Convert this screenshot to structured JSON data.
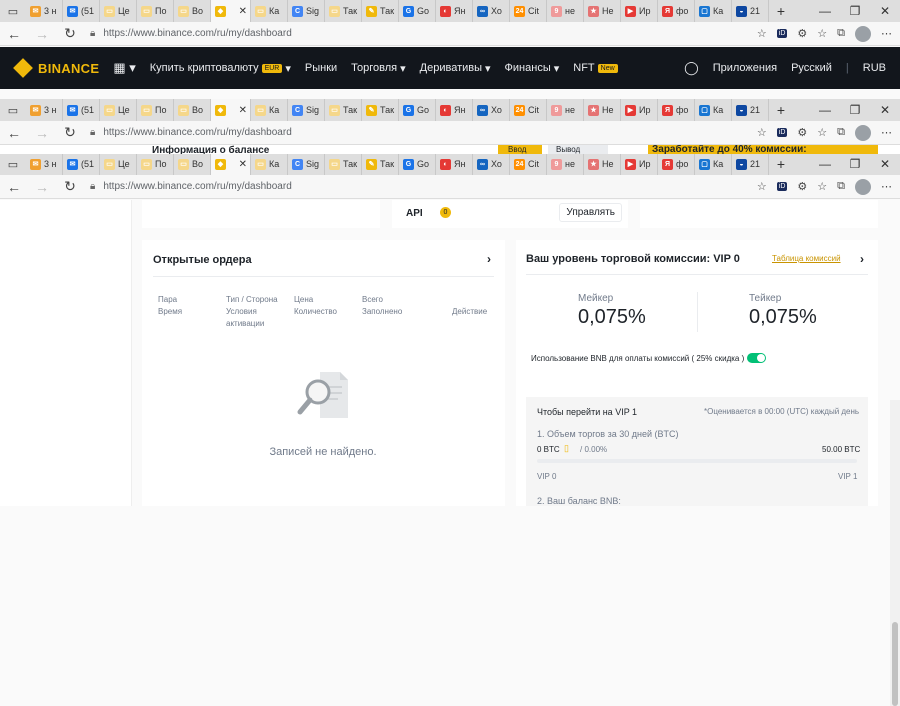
{
  "browser": {
    "tabs": [
      {
        "label": "3 н",
        "color": "#f0a030",
        "glyph": "✉"
      },
      {
        "label": "(51",
        "color": "#1a73e8",
        "glyph": "✉"
      },
      {
        "label": "Це",
        "color": "#f5d78a",
        "glyph": "▭"
      },
      {
        "label": "По",
        "color": "#f5d78a",
        "glyph": "▭"
      },
      {
        "label": "Во",
        "color": "#f5d78a",
        "glyph": "▭"
      },
      {
        "label": "",
        "color": "#f0b90b",
        "glyph": "◆",
        "active": true
      },
      {
        "label": "Ка",
        "color": "#f5d78a",
        "glyph": "▭"
      },
      {
        "label": "Sig",
        "color": "#4285f4",
        "glyph": "C"
      },
      {
        "label": "Так",
        "color": "#f5d78a",
        "glyph": "▭"
      },
      {
        "label": "Так",
        "color": "#f0b90b",
        "glyph": "✎"
      },
      {
        "label": "Go",
        "color": "#1a73e8",
        "glyph": "G"
      },
      {
        "label": "Ян",
        "color": "#e53935",
        "glyph": "◐"
      },
      {
        "label": "Хо",
        "color": "#1565c0",
        "glyph": "∞"
      },
      {
        "label": "Cit",
        "color": "#ff8f00",
        "glyph": "24"
      },
      {
        "label": "не",
        "color": "#ef9a9a",
        "glyph": "9"
      },
      {
        "label": "Не",
        "color": "#e57373",
        "glyph": "★"
      },
      {
        "label": "Ир",
        "color": "#e53935",
        "glyph": "▶"
      },
      {
        "label": "фо",
        "color": "#e53935",
        "glyph": "Я"
      },
      {
        "label": "Ка",
        "color": "#1976d2",
        "glyph": "▢"
      },
      {
        "label": "21",
        "color": "#0d47a1",
        "glyph": "◒"
      }
    ],
    "new_tab": "+",
    "url": "https://www.binance.com/ru/my/dashboard",
    "tool_id": "iD"
  },
  "binance_nav": {
    "logo": "BINANCE",
    "buy_crypto": "Купить криптовалюту",
    "buy_badge": "EUR",
    "markets": "Рынки",
    "trade": "Торговля",
    "derivatives": "Деривативы",
    "finance": "Финансы",
    "nft": "NFT",
    "nft_badge": "New",
    "apps": "Приложения",
    "language": "Русский",
    "currency": "RUB"
  },
  "partial": {
    "balance_title": "Информация о балансе",
    "deposit": "Ввод",
    "withdraw": "Вывод",
    "promo": "Заработайте до 40% комиссии:"
  },
  "api": {
    "label": "API",
    "count": "0",
    "manage": "Управлять"
  },
  "open_orders": {
    "title": "Открытые ордера",
    "col_pair": "Пара",
    "col_time": "Время",
    "col_type": "Тип / Сторона",
    "col_cond": "Условия активации",
    "col_price": "Цена",
    "col_qty": "Количество",
    "col_total": "Всего",
    "col_filled": "Заполнено",
    "col_action": "Действие",
    "empty": "Записей не найдено."
  },
  "fees": {
    "title": "Ваш уровень торговой комиссии: VIP 0",
    "table_link": "Таблица комиссий",
    "maker_label": "Мейкер",
    "maker_value": "0,075%",
    "taker_label": "Тейкер",
    "taker_value": "0,075%",
    "bnb_text": "Использование BNB для оплаты комиссий ( 25% скидка )",
    "vip_title": "Чтобы перейти на VIP 1",
    "vip_note": "*Оценивается в 00:00 (UTC) каждый день",
    "volume_label": "1. Объем торгов за 30 дней (BTC)",
    "volume_current": "0 BTC",
    "volume_percent": "/ 0.00%",
    "volume_target": "50.00 BTC",
    "vip0": "VIP 0",
    "vip1": "VIP 1",
    "bnb_balance": "2. Ваш баланс BNB:",
    "progress": 0
  }
}
